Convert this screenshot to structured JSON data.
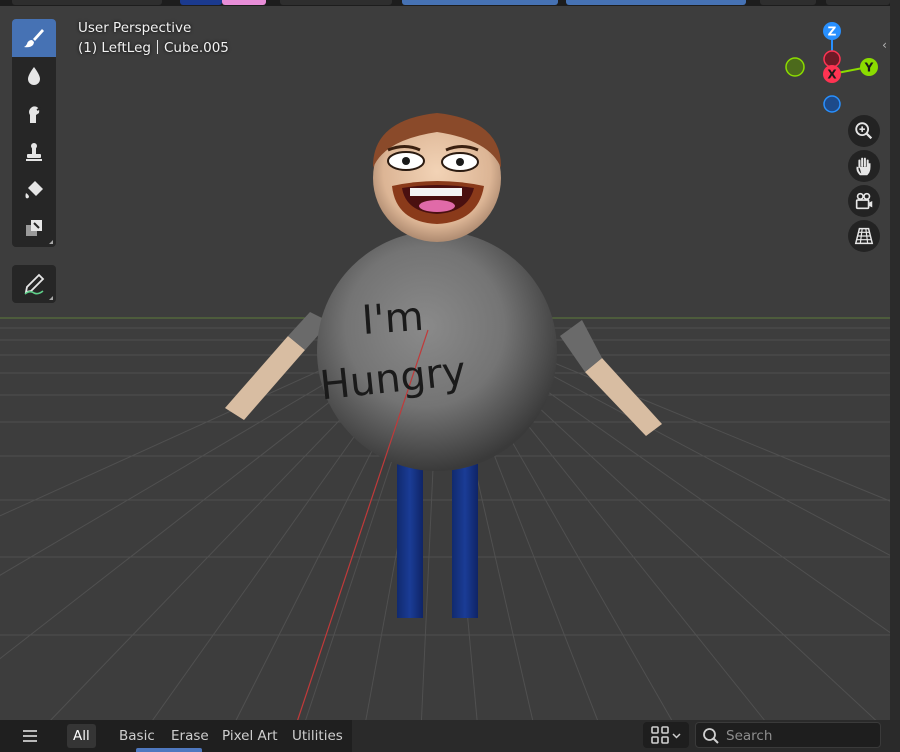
{
  "viewport": {
    "view_name": "User Perspective",
    "object_info": "(1) LeftLeg",
    "active_object": "Cube.005"
  },
  "scene": {
    "shirt_text_line1": "I'm",
    "shirt_text_line2": "Hungry"
  },
  "gizmo": {
    "z_label": "Z",
    "y_label": "Y",
    "x_label": "X",
    "colors": {
      "x": "#ff3352",
      "y": "#8bdc00",
      "z": "#2890ff"
    }
  },
  "toolbar": {
    "tools": [
      {
        "name": "draw-brush",
        "icon": "brush-icon",
        "active": true
      },
      {
        "name": "blur-brush",
        "icon": "drop-icon",
        "active": false
      },
      {
        "name": "smear-brush",
        "icon": "smear-icon",
        "active": false
      },
      {
        "name": "clone-brush",
        "icon": "stamp-icon",
        "active": false
      },
      {
        "name": "fill-brush",
        "icon": "bucket-icon",
        "active": false
      },
      {
        "name": "mask-brush",
        "icon": "mask-icon",
        "active": false
      },
      {
        "name": "annotate",
        "icon": "annotate-icon",
        "active": false
      }
    ]
  },
  "nav_buttons": [
    "zoom-icon",
    "pan-hand-icon",
    "camera-icon",
    "grid-view-icon"
  ],
  "asset_shelf": {
    "tabs": [
      "All",
      "Basic",
      "Erase",
      "Pixel Art",
      "Utilities"
    ],
    "active_tab": "All",
    "search_placeholder": "Search"
  },
  "colors": {
    "accent": "#4672b4",
    "viewport_bg": "#3d3d3d",
    "shelf_bg": "#2a2a2a"
  }
}
